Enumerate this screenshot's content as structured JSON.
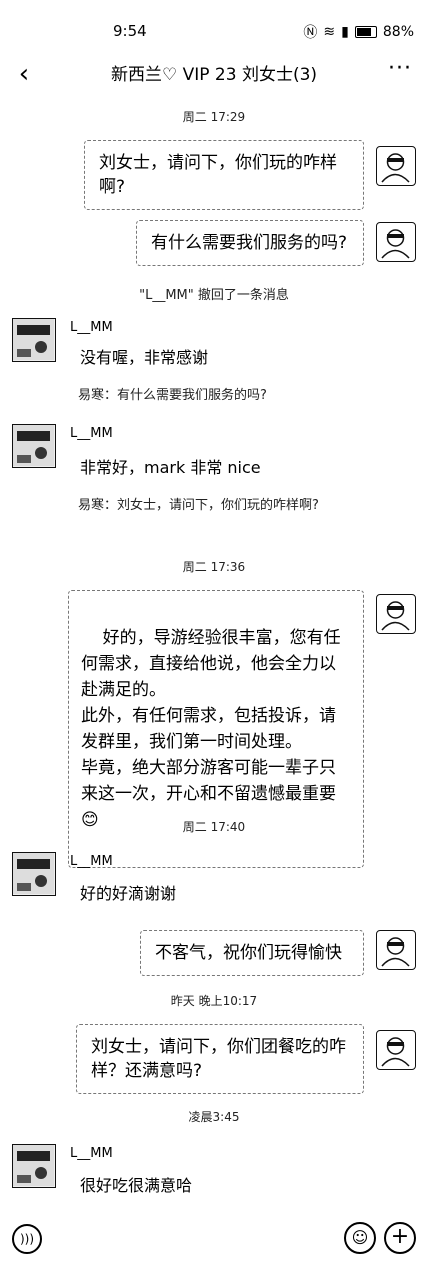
{
  "status_bar": {
    "time": "9:54",
    "battery": "88%"
  },
  "header": {
    "back_icon": "‹",
    "title": "新西兰♡ VIP 23  刘女士(3)",
    "more_icon": "···"
  },
  "timestamps": [
    "周二 17:29",
    "周二 17:36",
    "周二 17:40",
    "昨天 晚上10:17",
    "凌晨3:45"
  ],
  "system": {
    "recall": "\"L__MM\" 撤回了一条消息"
  },
  "messages": {
    "out1": "刘女士，请问下，你们玩的咋样啊?",
    "out2": "有什么需要我们服务的吗?",
    "in1_sender": "L__MM",
    "in1": "没有喔，非常感谢",
    "in1_quote": "易寒：有什么需要我们服务的吗?",
    "in2_sender": "L__MM",
    "in2": "非常好，mark 非常 nice",
    "in2_quote": "易寒：刘女士，请问下，你们玩的咋样啊?",
    "out3": "好的，导游经验很丰富，您有任何需求，直接给他说，他会全力以赴满足的。\n此外，有任何需求，包括投诉，请发群里，我们第一时间处理。\n毕竟，绝大部分游客可能一辈子只来这一次，开心和不留遗憾最重要😊",
    "in3_sender": "L__MM",
    "in3": "好的好滴谢谢",
    "out4": "不客气，祝你们玩得愉快",
    "out5": "刘女士，请问下，你们团餐吃的咋样？还满意吗?",
    "in4_sender": "L__MM",
    "in4": "很好吃很满意哈"
  },
  "icons": {
    "voice": "voice-icon",
    "emoji": "emoji-icon",
    "plus": "plus-icon",
    "back": "chevron-left-icon",
    "more": "more-icon"
  }
}
